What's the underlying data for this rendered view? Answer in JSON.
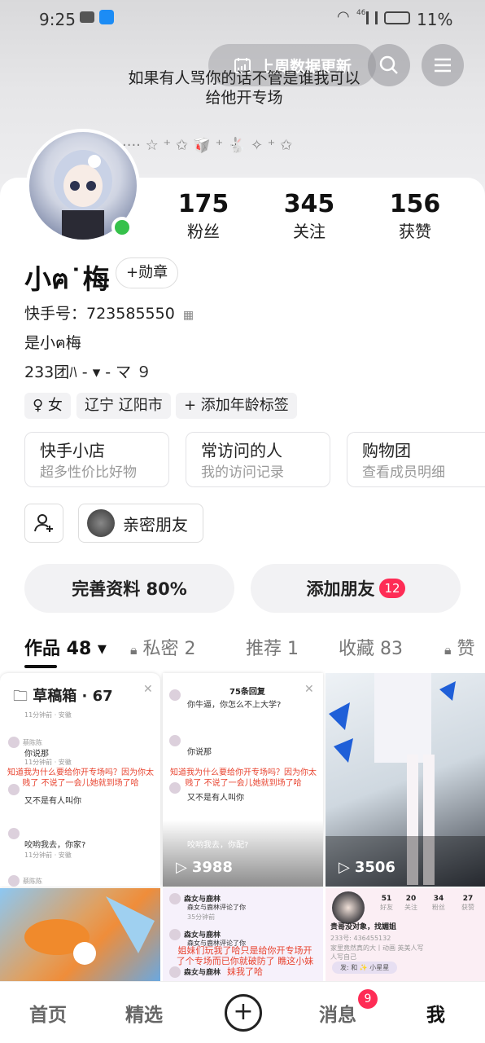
{
  "status_bar": {
    "time": "9:25",
    "signal": "46",
    "battery": "11%"
  },
  "header": {
    "update_chip": "上周数据更新",
    "signature_line1": "如果有人骂你的话不管是谁我可以",
    "signature_line2": "给他开专场",
    "deco_text": "···· ☆ ⁺ ✩ 🥡 ⁺ 🐇 ✧ ⁺ ✩"
  },
  "profile": {
    "stats": [
      {
        "value": "175",
        "label": "粉丝"
      },
      {
        "value": "345",
        "label": "关注"
      },
      {
        "value": "156",
        "label": "获赞"
      }
    ],
    "name": "小ฅ˙梅",
    "medal_label": "+勋章",
    "id_label": "快手号：723585550",
    "bio_line1": "是小ฅ梅",
    "bio_line2": "233团ﾊ ‐ ▾ ‐ マ ９",
    "tags": [
      "♀ 女",
      "辽宁 辽阳市",
      "+ 添加年龄标签"
    ],
    "services": [
      {
        "title": "快手小店",
        "sub": "超多性价比好物"
      },
      {
        "title": "常访问的人",
        "sub": "我的访问记录"
      },
      {
        "title": "购物团",
        "sub": "查看成员明细"
      }
    ],
    "friend_label": "亲密朋友",
    "complete_label": "完善资料 80%",
    "add_friend_label": "添加朋友",
    "add_friend_badge": "12"
  },
  "tabs": [
    {
      "label": "作品 48 ▾",
      "active": true
    },
    {
      "label": "私密 2",
      "lock": true
    },
    {
      "label": "推荐 1"
    },
    {
      "label": "收藏 83"
    },
    {
      "label": "赞",
      "lock": true
    }
  ],
  "grid": {
    "draft_title": "草稿箱 · 67",
    "replies_title": "75条回复",
    "chat_names": [
      "蔡陈陈",
      "蔡陈陈"
    ],
    "chat_msgs": [
      "你说那",
      "又不是有人叫你",
      "咬哟我去，你家?",
      "你牛逼，你怎么不上大学?",
      "你说那",
      "又不是有人叫你",
      "咬哟我去，你配?"
    ],
    "time_text": "11分钟前 · 安徽",
    "red_caption": "知道我为什么要给你开专场吗？因为你太贱了 不说了一会儿她就到场了哈",
    "play_counts": [
      "3988",
      "3506"
    ],
    "tile5_names": [
      "森女与鹿林",
      "森女与鹿林",
      "森女与鹿林"
    ],
    "tile5_sub": "森女与鹿林评论了你",
    "tile5_time": "35分钟前",
    "tile5_red": "姐妹们玩我了哈只是给你开专场开了个专场而已你就破防了 瞧这小妹妹我了哈",
    "tile6_stats": [
      {
        "n": "51",
        "l": "好友"
      },
      {
        "n": "20",
        "l": "关注"
      },
      {
        "n": "34",
        "l": "粉丝"
      },
      {
        "n": "27",
        "l": "获赞"
      }
    ],
    "tile6_name": "贵哥没对象，找媚姐",
    "tile6_id": "233号: 436455132",
    "tile6_bio": "家里竟然真的大丨动画 英美人写人写自己",
    "tile6_bubble": "发: 和 ✨ 小星星"
  },
  "bottom_nav": [
    {
      "label": "首页"
    },
    {
      "label": "精选"
    },
    {
      "label": "+"
    },
    {
      "label": "消息",
      "badge": "9"
    },
    {
      "label": "我",
      "active": true
    }
  ],
  "colors": {
    "accent": "#fe2c55",
    "online": "#35c14a"
  }
}
